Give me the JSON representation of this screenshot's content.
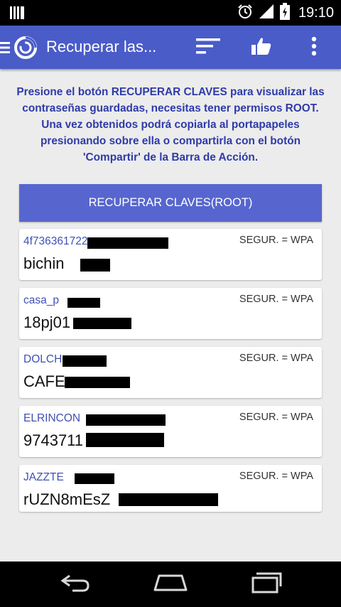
{
  "status_bar": {
    "time": "19:10",
    "icons": [
      "notification-icon",
      "alarm-icon",
      "signal-icon",
      "battery-icon"
    ]
  },
  "app_bar": {
    "title": "Recuperar las...",
    "actions": [
      "menu-icon",
      "app-logo-icon",
      "sort-icon",
      "thumbs-up-icon",
      "overflow-menu-icon"
    ],
    "color": "#4a5cc8"
  },
  "instructions": "Presione el botón RECUPERAR CLAVES para visualizar las contraseñas guardadas, necesitas tener permisos ROOT. Una vez obtenidos podrá copiarla al portapapeles presionando sobre ella o compartirla con el botón 'Compartir' de la Barra de Acción.",
  "recover_button": {
    "label": "RECUPERAR CLAVES(ROOT)"
  },
  "networks": [
    {
      "ssid": "4f736361722",
      "security": "SEGUR. = WPA",
      "password": "bichin"
    },
    {
      "ssid": "casa_p",
      "security": "SEGUR. = WPA",
      "password": "18pj01"
    },
    {
      "ssid": "DOLCH",
      "security": "SEGUR. = WPA",
      "password": "CAFE"
    },
    {
      "ssid": "ELRINCON",
      "security": "SEGUR. = WPA",
      "password": "9743711"
    },
    {
      "ssid": "JAZZTE",
      "security": "SEGUR. = WPA",
      "password": "rUZN8mEsZ"
    }
  ],
  "nav_bar": {
    "buttons": [
      "back-icon",
      "home-icon",
      "recent-apps-icon"
    ]
  }
}
